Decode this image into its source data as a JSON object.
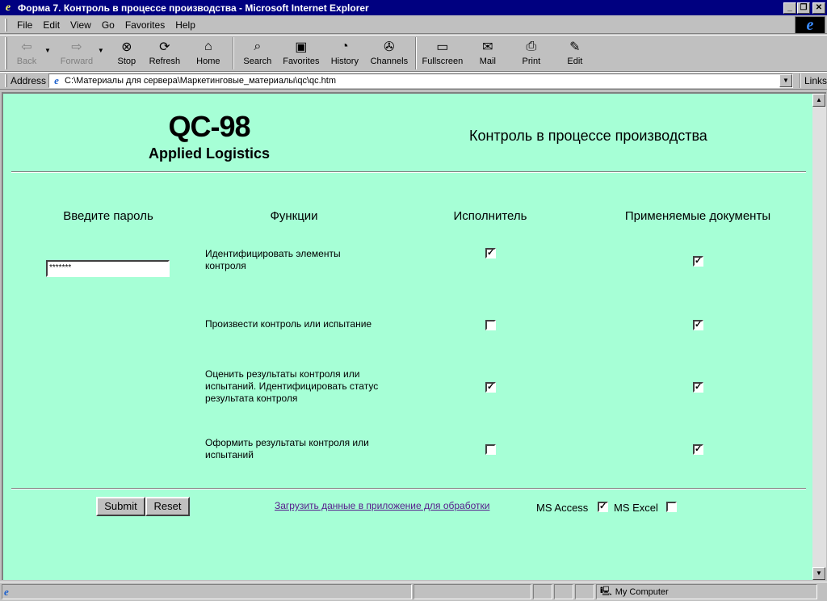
{
  "window": {
    "title": "Форма 7. Контроль в процессе производства - Microsoft Internet Explorer",
    "min_glyph": "_",
    "max_glyph": "❐",
    "close_glyph": "✕"
  },
  "menu": [
    "File",
    "Edit",
    "View",
    "Go",
    "Favorites",
    "Help"
  ],
  "toolbar": {
    "back": "Back",
    "forward": "Forward",
    "stop": "Stop",
    "refresh": "Refresh",
    "home": "Home",
    "search": "Search",
    "favorites": "Favorites",
    "history": "History",
    "channels": "Channels",
    "fullscreen": "Fullscreen",
    "mail": "Mail",
    "print": "Print",
    "edit": "Edit"
  },
  "address": {
    "label": "Address",
    "url": "C:\\Материалы для сервера\\Маркетинговые_материалы\\qc\\qc.htm",
    "links": "Links"
  },
  "page": {
    "logo_big": "QC-98",
    "logo_sub": "Applied Logistics",
    "title": "Контроль в процессе производства",
    "col_password": "Введите пароль",
    "col_functions": "Функции",
    "col_executor": "Исполнитель",
    "col_documents": "Применяемые документы",
    "password_value": "*******",
    "rows": [
      {
        "function": "Идентифицировать элементы контроля",
        "executor": true,
        "documents": true
      },
      {
        "function": "Произвести контроль или испытание",
        "executor": false,
        "documents": true
      },
      {
        "function": "Оценить результаты контроля или испытаний. Идентифицировать статус результата контроля",
        "executor": true,
        "documents": true
      },
      {
        "function": "Оформить результаты контроля или испытаний",
        "executor": false,
        "documents": true
      }
    ],
    "submit": "Submit",
    "reset": "Reset",
    "load_link": "Загрузить данные в приложение для обработки",
    "ms_access": "MS Access",
    "ms_access_checked": true,
    "ms_excel": "MS Excel",
    "ms_excel_checked": false
  },
  "status": {
    "zone": "My Computer"
  }
}
